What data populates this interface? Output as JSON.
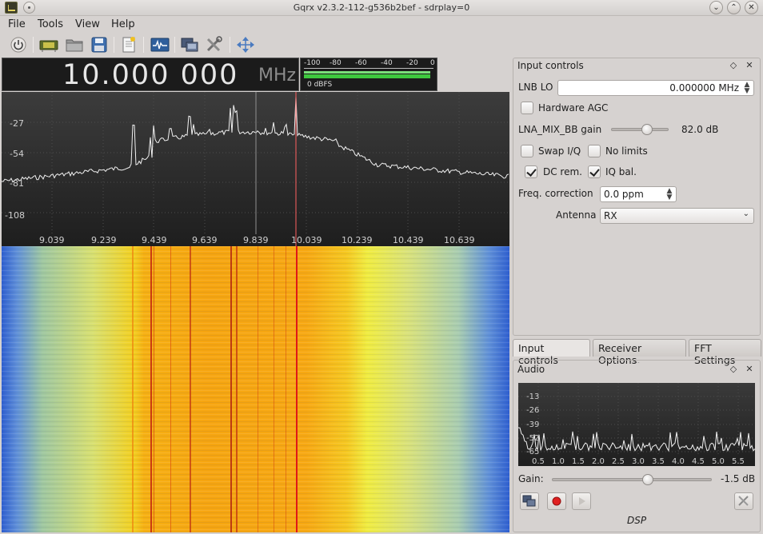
{
  "window": {
    "title": "Gqrx v2.3.2-112-g536b2bef - sdrplay=0",
    "buttons": [
      "minimize",
      "maximize",
      "close"
    ]
  },
  "menu": [
    "File",
    "Tools",
    "View",
    "Help"
  ],
  "toolbar_icons": [
    "power-icon",
    "hardware-icon",
    "folder-icon",
    "save-icon",
    "document-icon",
    "spectrum-icon",
    "network-icon",
    "tools-icon",
    "fullscreen-icon"
  ],
  "frequency": {
    "value": "10.000 000",
    "unit": "MHz"
  },
  "level_meter": {
    "scale": [
      "-100",
      "-80",
      "-60",
      "-40",
      "-20",
      "0"
    ],
    "label": "0 dBFS"
  },
  "spectrum": {
    "y_ticks": [
      "-27",
      "-54",
      "-81",
      "-108"
    ],
    "x_ticks": [
      "9.039",
      "9.239",
      "9.439",
      "9.639",
      "9.839",
      "10.039",
      "10.239",
      "10.439",
      "10.639"
    ],
    "colors": {
      "bg_top": "#3a3a3a",
      "bg_bottom": "#202020",
      "trace": "#f0f0f0",
      "center_line": "#ff6060"
    }
  },
  "input_controls": {
    "title": "Input controls",
    "lnb_lo_label": "LNB LO",
    "lnb_lo_value": "0.000000 MHz",
    "hardware_agc_label": "Hardware AGC",
    "hardware_agc_checked": false,
    "gain_label": "LNA_MIX_BB gain",
    "gain_value": "82.0 dB",
    "gain_level": 0.62,
    "swap_iq_label": "Swap I/Q",
    "swap_iq_checked": false,
    "no_limits_label": "No limits",
    "no_limits_checked": false,
    "dc_rem_label": "DC rem.",
    "dc_rem_checked": true,
    "iq_bal_label": "IQ bal.",
    "iq_bal_checked": true,
    "freq_corr_label": "Freq. correction",
    "freq_corr_value": "0.0 ppm",
    "antenna_label": "Antenna",
    "antenna_value": "RX"
  },
  "tabs": [
    "Input controls",
    "Receiver Options",
    "FFT Settings"
  ],
  "audio": {
    "title": "Audio",
    "y_ticks": [
      "-13",
      "-26",
      "-39",
      "-52",
      "-65"
    ],
    "x_ticks": [
      "0.5",
      "1.0",
      "1.5",
      "2.0",
      "2.5",
      "3.0",
      "3.5",
      "4.0",
      "4.5",
      "5.0",
      "5.5"
    ],
    "gain_label": "Gain:",
    "gain_value": "-1.5 dB",
    "gain_level": 0.6,
    "dsp_label": "DSP"
  }
}
